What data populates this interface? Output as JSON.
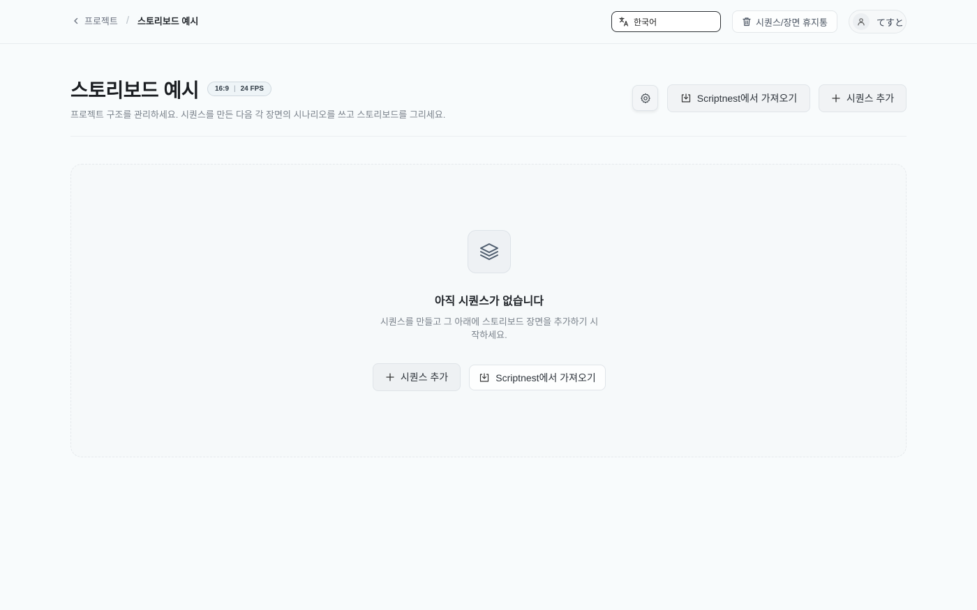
{
  "breadcrumb": {
    "back_label": "프로젝트",
    "separator": "/",
    "current": "스토리보드 예시"
  },
  "header": {
    "language": "한국어",
    "trash_label": "시퀀스/장면 휴지통",
    "user_name": "てすと"
  },
  "project": {
    "title": "스토리보드 예시",
    "aspect_ratio": "16:9",
    "fps": "24 FPS",
    "description": "프로젝트 구조를 관리하세요. 시퀀스를 만든 다음 각 장면의 시나리오를 쓰고 스토리보드를 그리세요."
  },
  "actions": {
    "import_label": "Scriptnest에서 가져오기",
    "add_sequence_label": "시퀀스 추가"
  },
  "empty_state": {
    "icon": "layers-icon",
    "title": "아직 시퀀스가 없습니다",
    "description": "시퀀스를 만들고 그 아래에 스토리보드 장면을 추가하기 시작하세요.",
    "add_label": "시퀀스 추가",
    "import_label": "Scriptnest에서 가져오기"
  }
}
